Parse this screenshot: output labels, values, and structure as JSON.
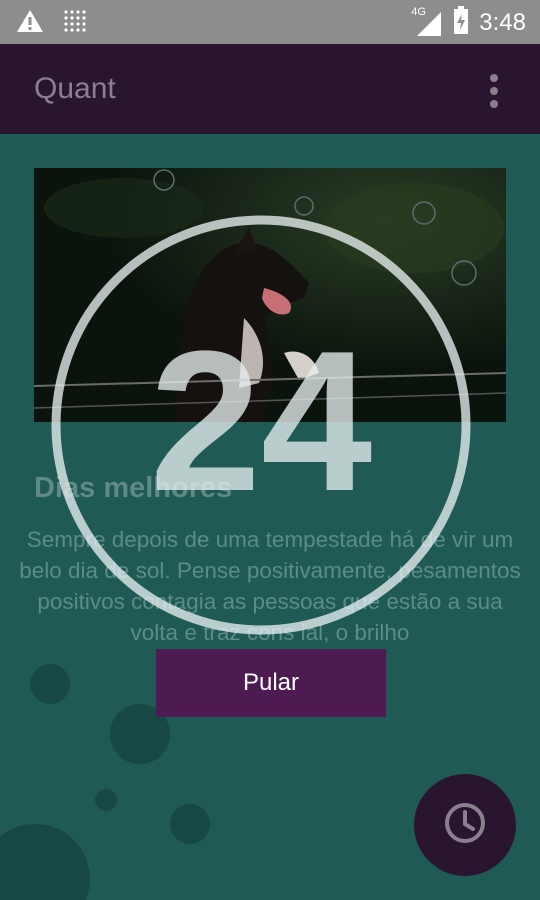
{
  "status_bar": {
    "network_label": "4G",
    "time": "3:48",
    "icons": [
      "warning-icon",
      "dots-grid-icon",
      "signal-icon",
      "battery-icon"
    ]
  },
  "app_bar": {
    "title": "Quant",
    "menu_icon": "overflow-menu-icon"
  },
  "card": {
    "title": "Dias melhores",
    "text": "Sempre depois de uma tempestade há de vir um belo dia de sol. Pense positivamente, pesamentos positivos contagia as pessoas que estão a sua volta e traz cons                              ial, o brilho"
  },
  "countdown": {
    "value": "24"
  },
  "skip_button": {
    "label": "Pular"
  },
  "fab": {
    "icon": "clock-icon"
  },
  "colors": {
    "app_bar": "#2a1530",
    "content_bg": "#1f5a55",
    "button": "#4d1b52",
    "status_bar": "#8d8d8d"
  }
}
